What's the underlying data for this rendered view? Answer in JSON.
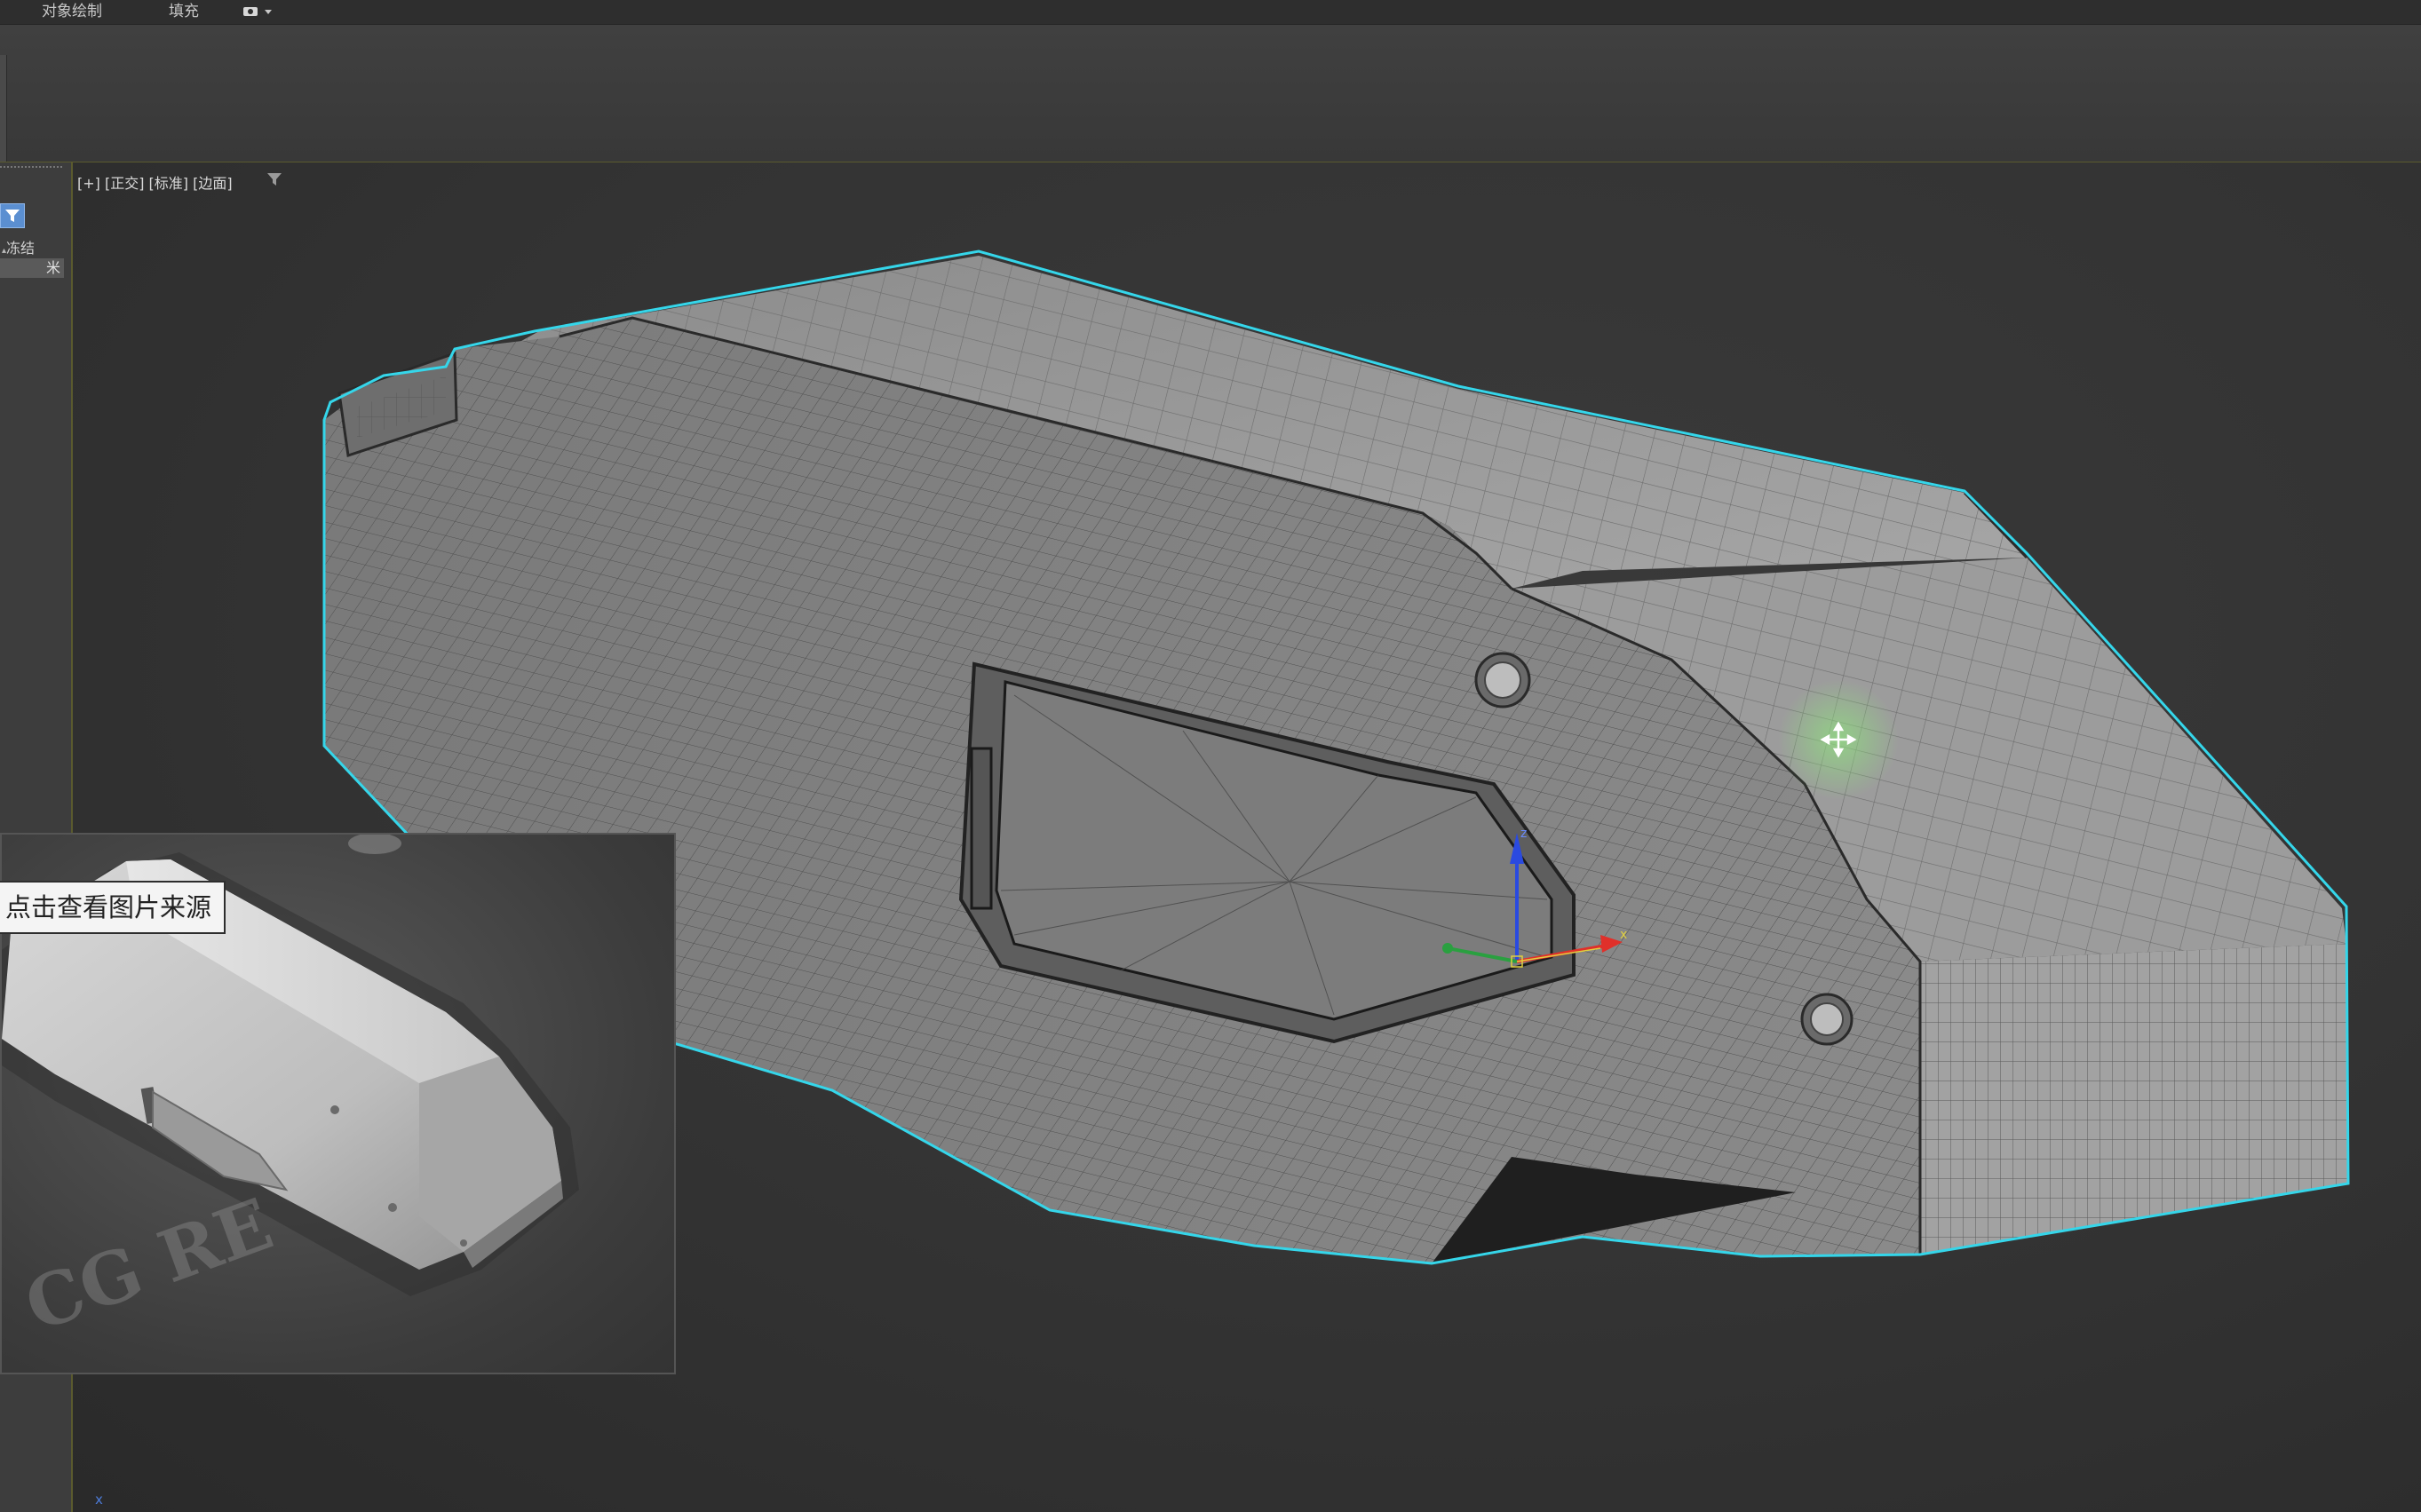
{
  "menubar": {
    "item1": "对象绘制",
    "item2": "填充"
  },
  "left_panel": {
    "freeze_label": "冻结",
    "freeze_value": "米"
  },
  "viewport": {
    "label": "[+] [正交] [标准] [边面]"
  },
  "reference": {
    "tooltip": "点击查看图片来源",
    "watermark": "CG RE"
  },
  "axis_marker": "x",
  "colors": {
    "selection_outline": "#35d6ea",
    "viewport_bg": "#333333",
    "mesh_light": "#9a9a9a",
    "mesh_dark": "#6a6a6a",
    "move_cursor_highlight": "#7fd46f",
    "gizmo_x": "#e0302a",
    "gizmo_y": "#2aa040",
    "gizmo_z": "#2a4ae0",
    "gizmo_center": "#e0d040"
  },
  "icons": {
    "camera": "camera-dropdown-icon",
    "filter": "funnel-icon",
    "move": "move-cursor-icon"
  }
}
